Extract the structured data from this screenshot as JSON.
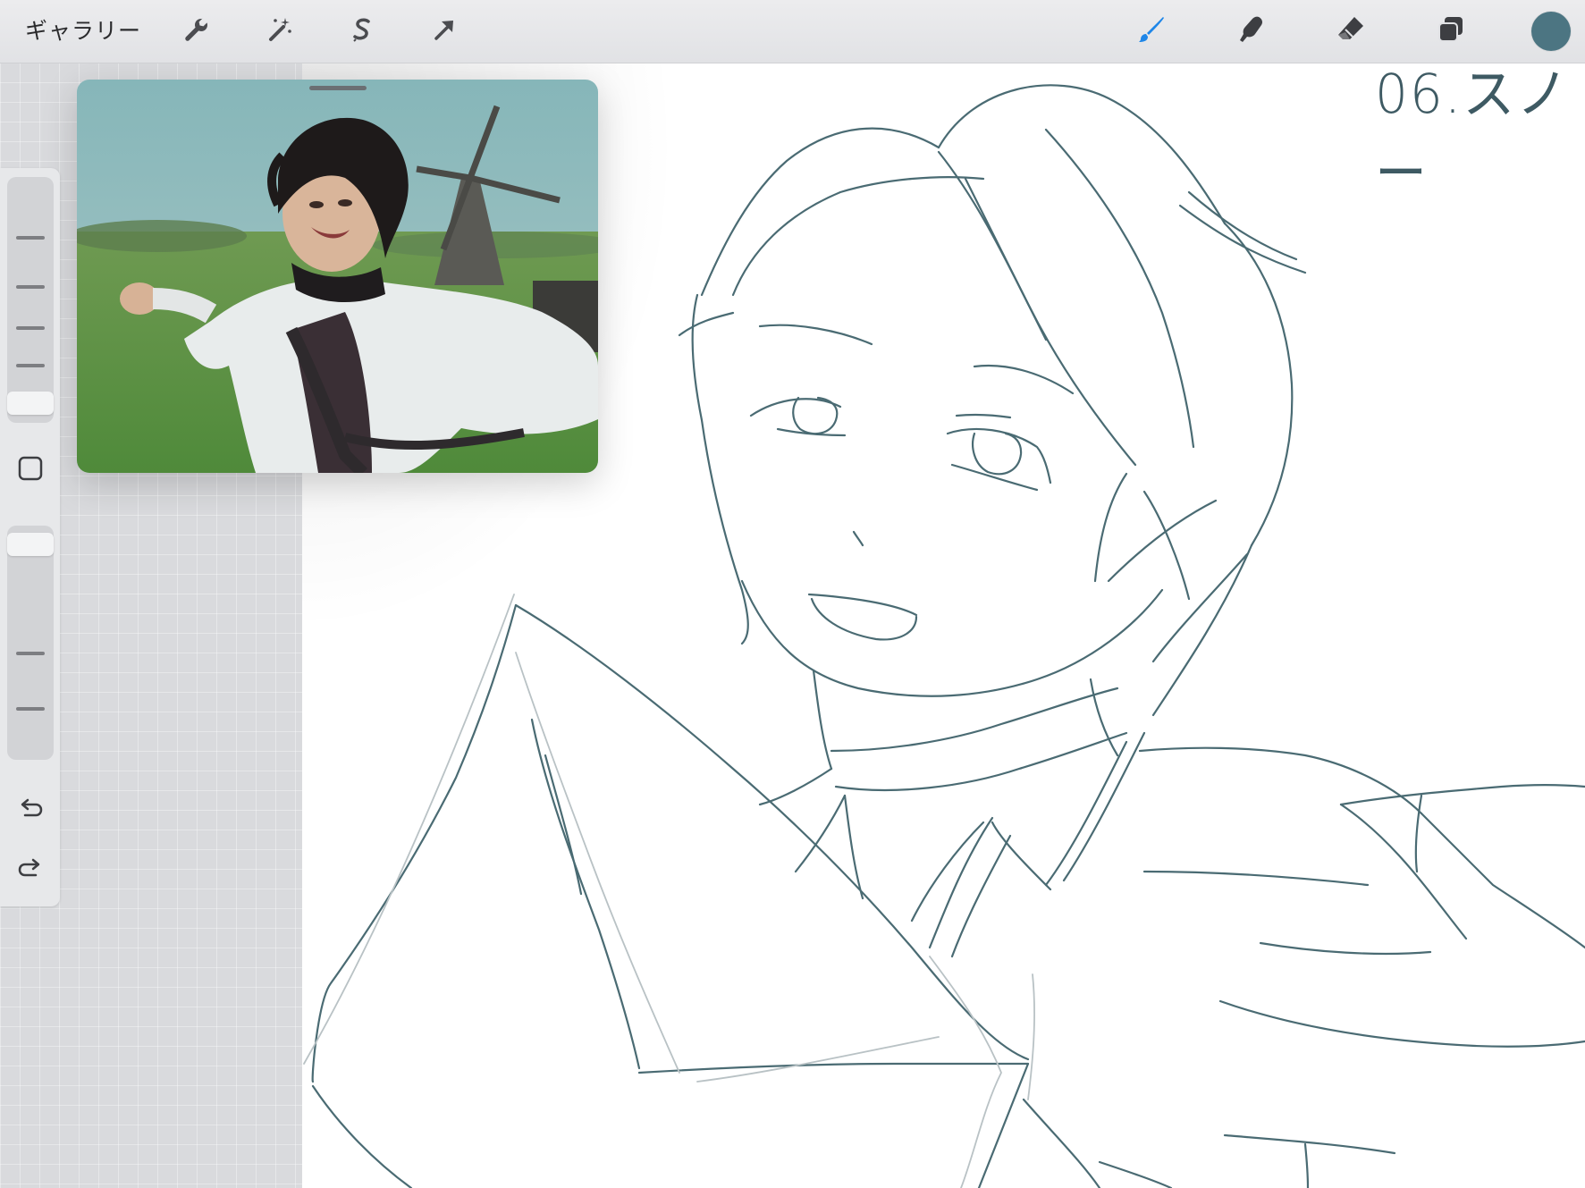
{
  "toolbar": {
    "gallery_label": "ギャラリー",
    "tools_left": [
      {
        "name": "actions",
        "icon": "wrench-icon"
      },
      {
        "name": "adjustments",
        "icon": "magic-wand-icon"
      },
      {
        "name": "selection",
        "icon": "selection-s-icon"
      },
      {
        "name": "transform",
        "icon": "arrow-cursor-icon"
      }
    ],
    "tools_right": [
      {
        "name": "brush",
        "icon": "brush-icon",
        "active": true
      },
      {
        "name": "smudge",
        "icon": "smudge-finger-icon",
        "active": false
      },
      {
        "name": "eraser",
        "icon": "eraser-icon",
        "active": false
      },
      {
        "name": "layers",
        "icon": "layers-icon",
        "active": false
      }
    ],
    "current_color": "#4c7582",
    "active_tool_color": "#1e86e8"
  },
  "sidebar": {
    "icons": [
      "square-modify-icon",
      "undo-icon",
      "redo-icon"
    ]
  },
  "reference": {
    "description_icon": "reference-photo"
  },
  "canvas": {
    "label": "06.スノー",
    "stroke_color": "#4a6b73"
  }
}
